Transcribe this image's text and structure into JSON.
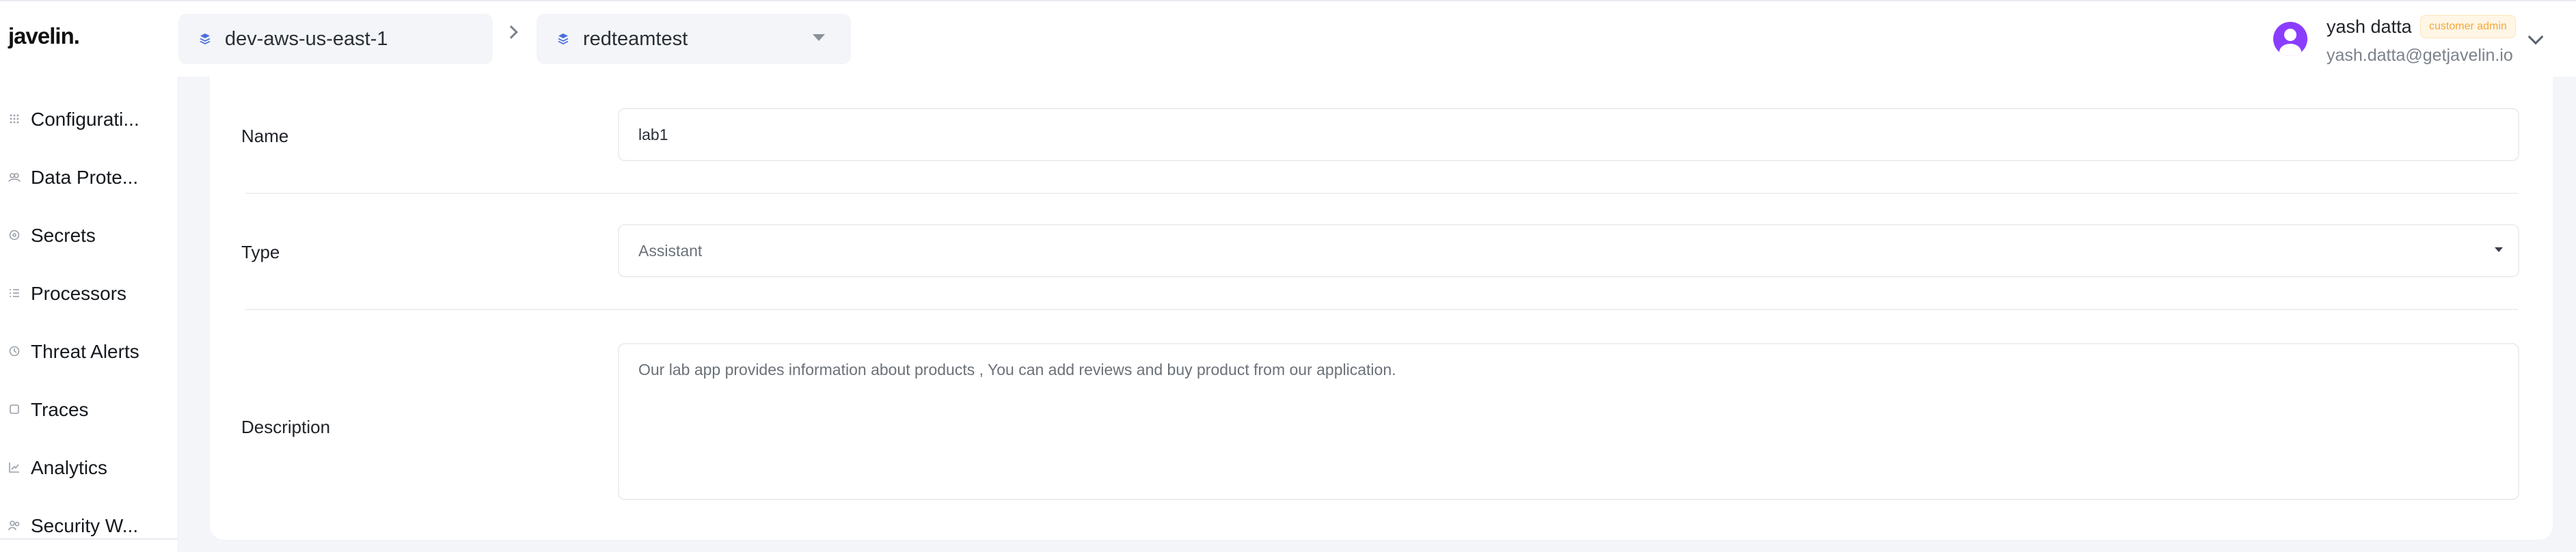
{
  "app": {
    "logo": "javelin."
  },
  "header": {
    "crumbs": [
      {
        "label": "dev-aws-us-east-1",
        "icon": "database-icon"
      },
      {
        "label": "redteamtest",
        "icon": "database-icon"
      }
    ],
    "separator_icon": "chevron-right-icon",
    "user": {
      "name": "yash datta",
      "role": "customer admin",
      "email": "yash.datta@getjavelin.io",
      "avatar_color": "#8b3dff"
    }
  },
  "sidebar": {
    "items": [
      {
        "label": "Configurati...",
        "icon": "grid-icon"
      },
      {
        "label": "Data Prote...",
        "icon": "shield-people-icon"
      },
      {
        "label": "Secrets",
        "icon": "key-circle-icon"
      },
      {
        "label": "Processors",
        "icon": "list-icon"
      },
      {
        "label": "Threat Alerts",
        "icon": "alert-clock-icon"
      },
      {
        "label": "Traces",
        "icon": "square-icon"
      },
      {
        "label": "Analytics",
        "icon": "chart-icon"
      },
      {
        "label": "Security W...",
        "icon": "users-icon"
      }
    ]
  },
  "form": {
    "name": {
      "label": "Name",
      "value": "lab1"
    },
    "type": {
      "label": "Type",
      "value": "Assistant"
    },
    "description": {
      "label": "Description",
      "value": "Our lab app provides information about products , You can add reviews and buy product from our application."
    }
  },
  "colors": {
    "accent": "#8b3dff",
    "badge_text": "#f3a73a",
    "badge_bg": "#fff6e6",
    "page_bg": "#f3f5f8"
  }
}
